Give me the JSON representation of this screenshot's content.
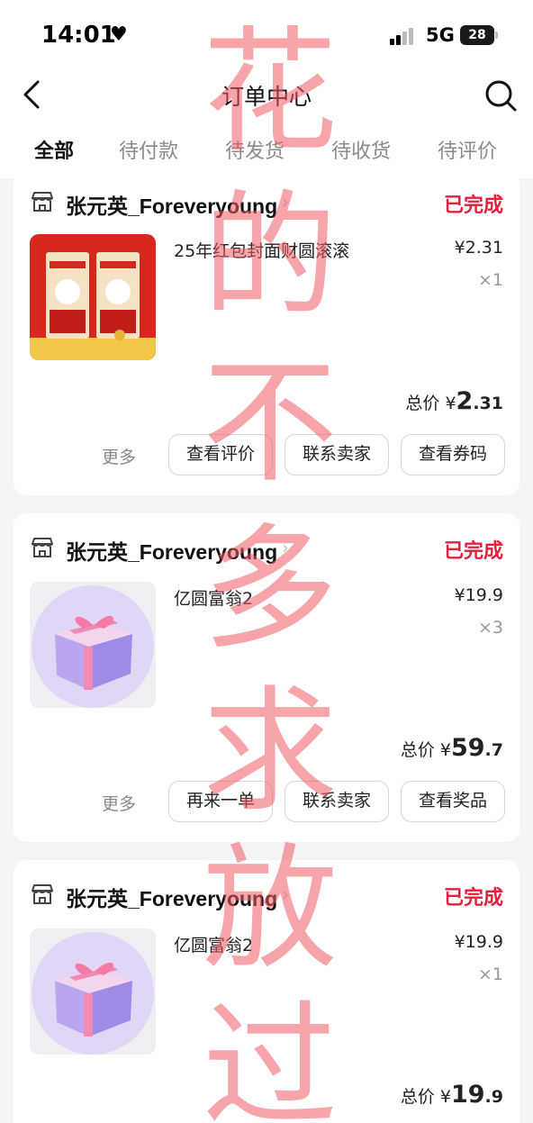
{
  "status_bar": {
    "time": "14:01",
    "network": "5G",
    "battery": "28"
  },
  "nav": {
    "title": "订单中心"
  },
  "tabs": [
    {
      "label": "全部",
      "active": true
    },
    {
      "label": "待付款"
    },
    {
      "label": "待发货"
    },
    {
      "label": "待收货"
    },
    {
      "label": "待评价"
    }
  ],
  "orders": [
    {
      "shop": "张元英_Foreveryoung",
      "status": "已完成",
      "product": "25年红包封面财圆滚滚",
      "price": "¥2.31",
      "qty": "×1",
      "total_label": "总价",
      "total_currency": "¥",
      "total_int": "2",
      "total_dec": ".31",
      "more": "更多",
      "buttons": [
        "查看评价",
        "联系卖家",
        "查看券码"
      ]
    },
    {
      "shop": "张元英_Foreveryoung",
      "status": "已完成",
      "product": "亿圆富翁2",
      "price": "¥19.9",
      "qty": "×3",
      "total_label": "总价",
      "total_currency": "¥",
      "total_int": "59",
      "total_dec": ".7",
      "more": "更多",
      "buttons": [
        "再来一单",
        "联系卖家",
        "查看奖品"
      ]
    },
    {
      "shop": "张元英_Foreveryoung",
      "status": "已完成",
      "product": "亿圆富翁2",
      "price": "¥19.9",
      "qty": "×1",
      "total_label": "总价",
      "total_currency": "¥",
      "total_int": "19",
      "total_dec": ".9"
    }
  ],
  "watermark": [
    "花",
    "的",
    "不",
    "多",
    "求",
    "放",
    "过"
  ],
  "colors": {
    "accent": "#e0223f",
    "watermark": "#f05a64"
  }
}
